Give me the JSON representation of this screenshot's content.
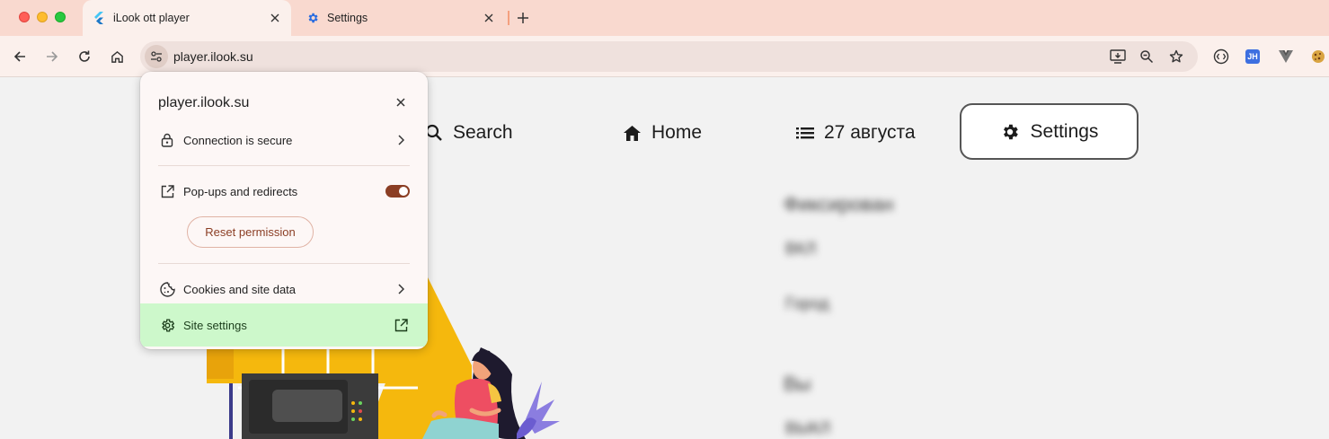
{
  "browser": {
    "tabs": [
      {
        "title": "iLook ott player",
        "active": true,
        "favicon": "flutter-icon"
      },
      {
        "title": "Settings",
        "active": false,
        "favicon": "gear-icon"
      }
    ],
    "url": "player.ilook.su"
  },
  "page": {
    "nav": {
      "search": "Search",
      "home": "Home",
      "date": "27 августа",
      "settings": "Settings"
    },
    "blurred": [
      "Фиксирован",
      "ВКЛ",
      "Город",
      "Вы",
      "ВЫКЛ"
    ]
  },
  "popup": {
    "title": "player.ilook.su",
    "connection": "Connection is secure",
    "popups": "Pop-ups and redirects",
    "popups_enabled": true,
    "reset": "Reset permission",
    "cookies": "Cookies and site data",
    "site_settings": "Site settings"
  },
  "colors": {
    "tabstrip": "#f9d9cf",
    "toolbar": "#fbf0ec",
    "toggle": "#8b3e24",
    "highlight": "#cdf8cb"
  }
}
